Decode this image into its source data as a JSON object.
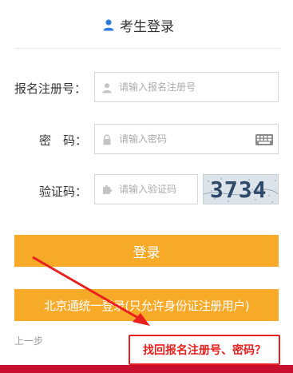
{
  "header": {
    "title": "考生登录",
    "icon": "user-icon"
  },
  "form": {
    "reg_label": "报名注册号：",
    "reg_placeholder": "请输入报名注册号",
    "password_label": "密　码：",
    "password_placeholder": "请输入密码",
    "captcha_label": "验证码：",
    "captcha_placeholder": "请输入验证码",
    "captcha_text": "3734"
  },
  "buttons": {
    "login": "登录",
    "beijing_login": "北京通统一登录(只允许身份证注册用户)"
  },
  "links": {
    "back": "上一步",
    "recover": "找回报名注册号、密码？"
  },
  "colors": {
    "accent": "#f7a928",
    "highlight": "#e8201e",
    "footer": "#c8102e"
  }
}
